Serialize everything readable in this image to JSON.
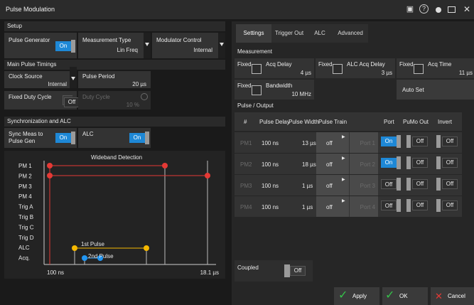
{
  "window": {
    "title": "Pulse Modulation"
  },
  "setup": {
    "header": "Setup",
    "pulse_generator": {
      "label": "Pulse Generator",
      "state": "On"
    },
    "measurement_type": {
      "label": "Measurement Type",
      "value": "Lin Freq"
    },
    "modulator_control": {
      "label": "Modulator Control",
      "value": "Internal"
    }
  },
  "timings": {
    "header": "Main Pulse Timings",
    "clock_source": {
      "label": "Clock Source",
      "value": "Internal"
    },
    "pulse_period": {
      "label": "Pulse Period",
      "value": "20 µs"
    },
    "fixed_duty_cycle": {
      "label": "Fixed Duty Cycle",
      "state": "Off"
    },
    "duty_cycle": {
      "label": "Duty Cycle",
      "value": "10 %"
    }
  },
  "sync": {
    "header": "Synchronization and ALC",
    "sync_meas": {
      "label_line1": "Sync Meas to",
      "label_line2": "Pulse Gen",
      "state": "On"
    },
    "alc": {
      "label": "ALC",
      "state": "On"
    }
  },
  "diagram": {
    "title": "Wideband Detection",
    "rows": [
      "PM 1",
      "PM 2",
      "PM 3",
      "PM 4",
      "Trig A",
      "Trig B",
      "Trig C",
      "Trig D",
      "ALC",
      "Acq."
    ],
    "x_start": "100 ns",
    "x_end": "18.1 µs",
    "label_1st": "1st Pulse",
    "label_2nd": "2nd Pulse",
    "colors": {
      "pm": "#e53935",
      "alc": "#f5b800",
      "acq": "#2196f3"
    }
  },
  "tabs": [
    "Settings",
    "Trigger Out",
    "ALC",
    "Advanced"
  ],
  "measurement": {
    "header": "Measurement",
    "fixed_label": "Fixed",
    "acq_delay": {
      "label": "Acq Delay",
      "value": "4 µs"
    },
    "alc_acq_delay": {
      "label": "ALC Acq Delay",
      "value": "3 µs"
    },
    "acq_time": {
      "label": "Acq Time",
      "value": "11 µs"
    },
    "bandwidth": {
      "label": "Bandwidth",
      "value": "10 MHz"
    },
    "auto_set": "Auto Set"
  },
  "pulse_output": {
    "header": "Pulse / Output",
    "columns": [
      "#",
      "Pulse Delay",
      "Pulse Width",
      "Pulse Train",
      "",
      "Port",
      "PuMo Out",
      "Invert"
    ],
    "rows": [
      {
        "name": "PM1",
        "delay": "100 ns",
        "width": "13 µs",
        "train": "off",
        "port_label": "Port 1",
        "port": "On",
        "pumo": "Off",
        "invert": "Off"
      },
      {
        "name": "PM2",
        "delay": "100 ns",
        "width": "18 µs",
        "train": "off",
        "port_label": "Port 2",
        "port": "On",
        "pumo": "Off",
        "invert": "Off"
      },
      {
        "name": "PM3",
        "delay": "100 ns",
        "width": "1 µs",
        "train": "off",
        "port_label": "Port 3",
        "port": "Off",
        "pumo": "Off",
        "invert": "Off"
      },
      {
        "name": "PM4",
        "delay": "100 ns",
        "width": "1 µs",
        "train": "off",
        "port_label": "Port 4",
        "port": "Off",
        "pumo": "Off",
        "invert": "Off"
      }
    ]
  },
  "coupled": {
    "label": "Coupled",
    "state": "Off"
  },
  "footer": {
    "apply": "Apply",
    "ok": "OK",
    "cancel": "Cancel"
  }
}
